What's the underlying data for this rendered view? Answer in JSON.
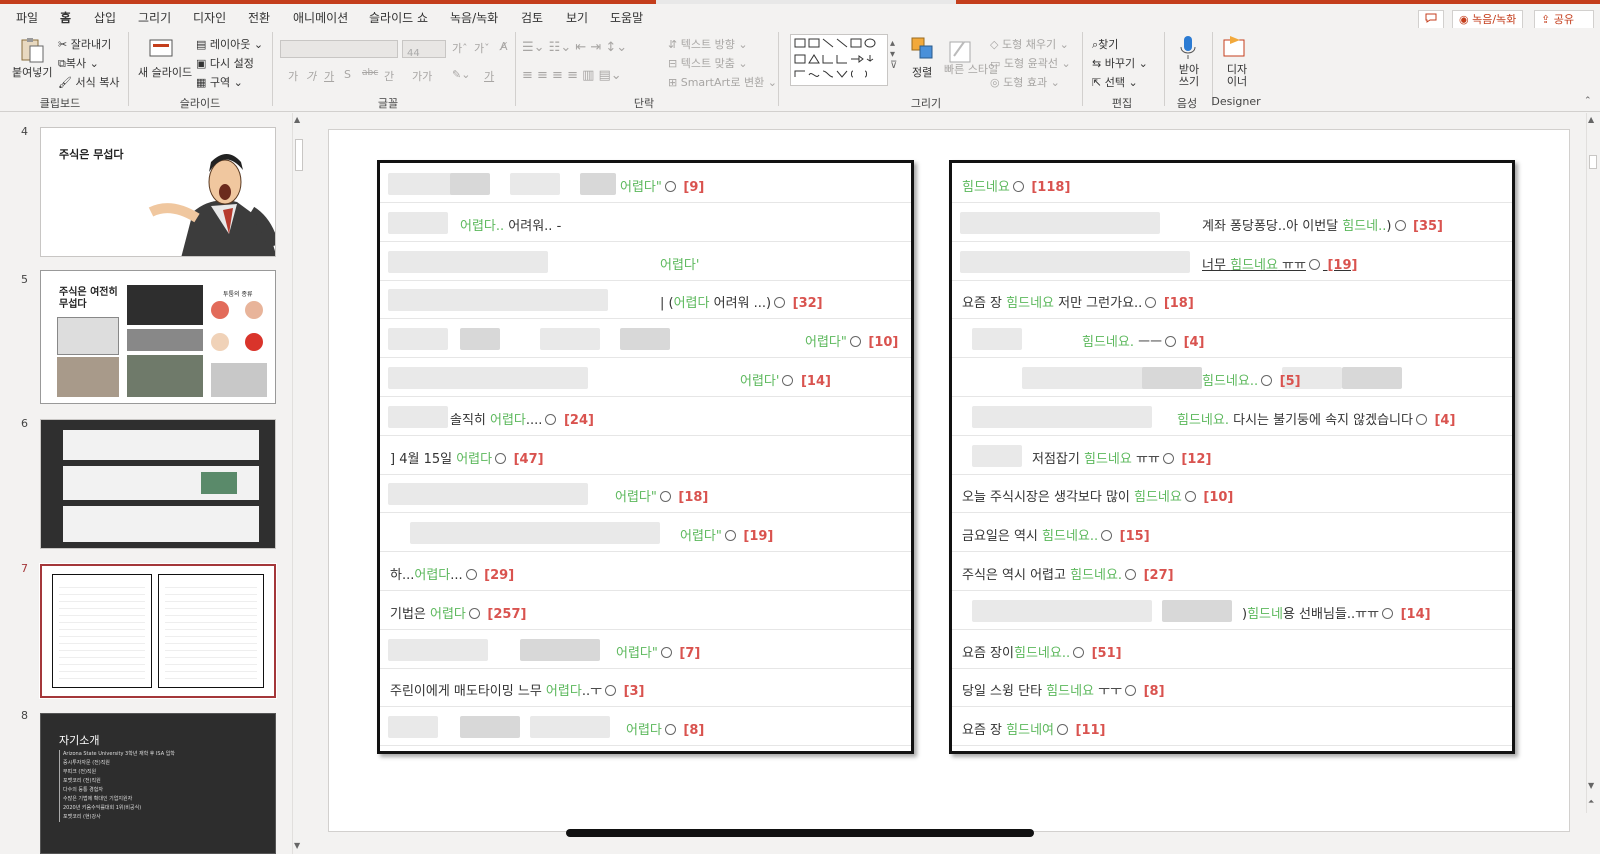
{
  "menu": {
    "tabs": [
      "파일",
      "홈",
      "삽입",
      "그리기",
      "디자인",
      "전환",
      "애니메이션",
      "슬라이드 쇼",
      "녹음/녹화",
      "검토",
      "보기",
      "도움말"
    ],
    "active": "홈",
    "record_button": "◉ 녹음/녹화",
    "share_button": "공유"
  },
  "ribbon": {
    "clipboard": {
      "paste": "붙여넣기",
      "cut": "잘라내기",
      "copy": "복사",
      "format_painter": "서식 복사",
      "label": "클립보드"
    },
    "slides": {
      "new_slide": "새 슬라이드",
      "layout": "레이아웃",
      "reset": "다시 설정",
      "section": "구역",
      "label": "슬라이드"
    },
    "font": {
      "size": "44",
      "label": "글꼴",
      "buttons": [
        "가",
        "가",
        "가",
        "S",
        "abc",
        "간",
        "가가",
        "가"
      ]
    },
    "paragraph": {
      "text_direction": "텍스트 방향",
      "align_text": "텍스트 맞춤",
      "smartart": "SmartArt로 변환",
      "label": "단락"
    },
    "drawing": {
      "arrange": "정렬",
      "quick_styles": "빠른 스타일",
      "shape_fill": "도형 채우기",
      "shape_outline": "도형 윤곽선",
      "shape_effects": "도형 효과",
      "label": "그리기"
    },
    "editing": {
      "find": "찾기",
      "replace": "바꾸기",
      "select": "선택",
      "label": "편집"
    },
    "voice": {
      "dictate": "받아 쓰기",
      "label": "음성"
    },
    "designer": {
      "button": "디자 이너",
      "label": "Designer"
    }
  },
  "thumbnails": [
    {
      "number": "4",
      "title": "주식은 무섭다"
    },
    {
      "number": "5",
      "title": "주식은 여전히 무섭다",
      "caption": "투툼의 종류"
    },
    {
      "number": "6"
    },
    {
      "number": "7",
      "selected": true
    },
    {
      "number": "8",
      "title": "자기소개",
      "bullets": [
        "Arizona State University 3학년 재학 후 ISA 입학",
        "증시투자자문 (전)직원",
        "부띠크 (전)직원",
        "포맷코리 (전)직원",
        "다수의 등통 경험자",
        "수많은 기법에 확대인 기업지원자",
        "2020년 키움수익률대회 1위(비공식)",
        "포맷코리 (현)강사"
      ]
    }
  ],
  "slide": {
    "left_panel": [
      {
        "pre": "",
        "hl": "어렵다\"",
        "post": "",
        "count": "[9]"
      },
      {
        "pre": "",
        "hl": "어렵다..",
        "post": " 어려워.. -",
        "count": ""
      },
      {
        "pre": "",
        "hl": "어렵다'",
        "post": "",
        "count": ""
      },
      {
        "pre": "| (",
        "hl": "어렵다",
        "post": " 어려워 ...)",
        "count": "[32]"
      },
      {
        "pre": "",
        "hl": "어렵다\"",
        "post": "",
        "count": "[10]"
      },
      {
        "pre": "",
        "hl": "어렵다'",
        "post": "",
        "count": "[14]"
      },
      {
        "pre": "솔직히 ",
        "hl": "어렵다",
        "post": "....",
        "count": "[24]"
      },
      {
        "pre": "] 4월 15일 ",
        "hl": "어렵다",
        "post": "",
        "count": "[47]"
      },
      {
        "pre": "",
        "hl": "어렵다\"",
        "post": "",
        "count": "[18]"
      },
      {
        "pre": "",
        "hl": "어렵다\"",
        "post": "",
        "count": "[19]"
      },
      {
        "pre": "하...",
        "hl": "어렵다",
        "post": "...",
        "count": "[29]"
      },
      {
        "pre": "기법은 ",
        "hl": "어렵다",
        "post": "",
        "count": "[257]"
      },
      {
        "pre": "",
        "hl": "어렵다\"",
        "post": "",
        "count": "[7]"
      },
      {
        "pre": "주린이에게 매도타이밍 느무 ",
        "hl": "어렵다",
        "post": "..ㅜ",
        "count": "[3]"
      },
      {
        "pre": "",
        "hl": "어렵다",
        "post": "",
        "count": "[8]"
      }
    ],
    "right_panel": [
      {
        "pre": "",
        "hl": "힘드네요",
        "post": "",
        "count": "[118]"
      },
      {
        "pre": "계좌 퐁당퐁당..아 이번달 ",
        "hl": "힘드네..",
        "post": ")",
        "count": "[35]"
      },
      {
        "pre": "너무 ",
        "hl": "힘드네요",
        "post": " ㅠㅠ",
        "count": "[19]"
      },
      {
        "pre": "요즘 장 ",
        "hl": "힘드네요",
        "post": " 저만 그런가요..",
        "count": "[18]"
      },
      {
        "pre": "",
        "hl": "힘드네요.",
        "post": " ㅡㅡ",
        "count": "[4]"
      },
      {
        "pre": "",
        "hl": "힘드네요..",
        "post": "",
        "count": "[5]"
      },
      {
        "pre": "",
        "hl": "힘드네요.",
        "post": " 다시는 불기둥에 속지 않겠습니다",
        "count": "[4]"
      },
      {
        "pre": "저점잡기 ",
        "hl": "힘드네요",
        "post": " ㅠㅠ",
        "count": "[12]"
      },
      {
        "pre": "오늘 주식시장은 생각보다 많이 ",
        "hl": "힘드네요",
        "post": "",
        "count": "[10]"
      },
      {
        "pre": "금요일은 역시 ",
        "hl": "힘드네요..",
        "post": "",
        "count": "[15]"
      },
      {
        "pre": "주식은 역시 어렵고 ",
        "hl": "힘드네요.",
        "post": "",
        "count": "[27]"
      },
      {
        "pre": ")",
        "hl": "힘드네",
        "post": "용 선배님들..ㅠㅠ",
        "count": "[14]"
      },
      {
        "pre": "요즘 장이",
        "hl": "힘드네요..",
        "post": "",
        "count": "[51]"
      },
      {
        "pre": "당일 스윙 단타 ",
        "hl": "힘드네요",
        "post": " ㅜㅜ",
        "count": "[8]"
      },
      {
        "pre": "요즘 장 ",
        "hl": "힘드네여",
        "post": "",
        "count": "[11]"
      }
    ]
  }
}
